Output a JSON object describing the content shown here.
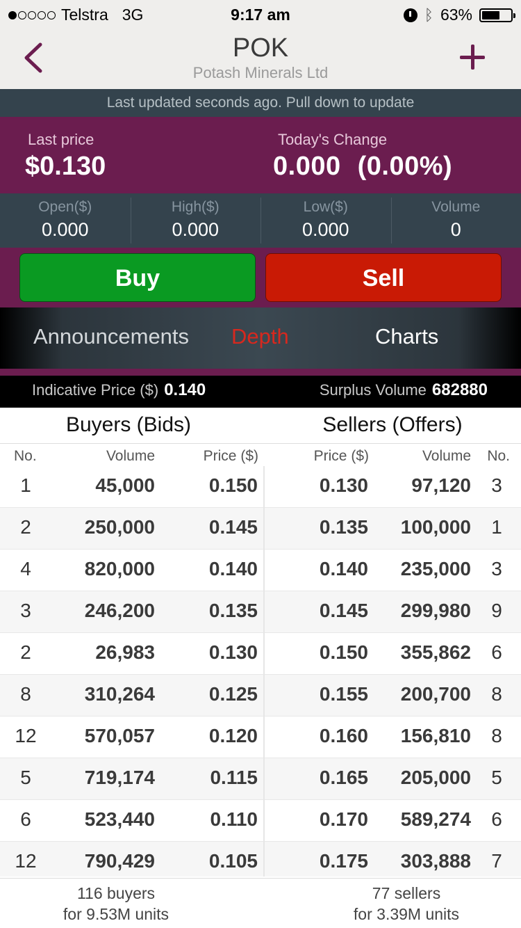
{
  "status_bar": {
    "carrier": "Telstra",
    "network": "3G",
    "time": "9:17 am",
    "battery_percent": "63%",
    "battery_level": 0.63,
    "signal_bars": 1
  },
  "nav": {
    "title": "POK",
    "subtitle": "Potash Minerals Ltd"
  },
  "banner": {
    "text": "Last updated seconds ago. Pull down to update"
  },
  "price": {
    "last_price_label": "Last price",
    "last_price_value": "$0.130",
    "change_label": "Today's Change",
    "change_value": "0.000",
    "change_percent": "(0.00%)"
  },
  "stats": [
    {
      "label": "Open($)",
      "value": "0.000"
    },
    {
      "label": "High($)",
      "value": "0.000"
    },
    {
      "label": "Low($)",
      "value": "0.000"
    },
    {
      "label": "Volume",
      "value": "0"
    }
  ],
  "actions": {
    "buy_label": "Buy",
    "sell_label": "Sell"
  },
  "tabs": {
    "announcements": "Announcements",
    "depth": "Depth",
    "charts": "Charts",
    "active": "Depth"
  },
  "indicative": {
    "price_label": "Indicative Price ($)",
    "price_value": "0.140",
    "surplus_label": "Surplus Volume",
    "surplus_value": "682880"
  },
  "depth": {
    "buyers_title": "Buyers (Bids)",
    "sellers_title": "Sellers (Offers)",
    "columns": {
      "no": "No.",
      "volume": "Volume",
      "price": "Price ($)"
    },
    "rows": [
      {
        "b_no": "1",
        "b_vol": "45,000",
        "b_price": "0.150",
        "s_price": "0.130",
        "s_vol": "97,120",
        "s_no": "3"
      },
      {
        "b_no": "2",
        "b_vol": "250,000",
        "b_price": "0.145",
        "s_price": "0.135",
        "s_vol": "100,000",
        "s_no": "1"
      },
      {
        "b_no": "4",
        "b_vol": "820,000",
        "b_price": "0.140",
        "s_price": "0.140",
        "s_vol": "235,000",
        "s_no": "3"
      },
      {
        "b_no": "3",
        "b_vol": "246,200",
        "b_price": "0.135",
        "s_price": "0.145",
        "s_vol": "299,980",
        "s_no": "9"
      },
      {
        "b_no": "2",
        "b_vol": "26,983",
        "b_price": "0.130",
        "s_price": "0.150",
        "s_vol": "355,862",
        "s_no": "6"
      },
      {
        "b_no": "8",
        "b_vol": "310,264",
        "b_price": "0.125",
        "s_price": "0.155",
        "s_vol": "200,700",
        "s_no": "8"
      },
      {
        "b_no": "12",
        "b_vol": "570,057",
        "b_price": "0.120",
        "s_price": "0.160",
        "s_vol": "156,810",
        "s_no": "8"
      },
      {
        "b_no": "5",
        "b_vol": "719,174",
        "b_price": "0.115",
        "s_price": "0.165",
        "s_vol": "205,000",
        "s_no": "5"
      },
      {
        "b_no": "6",
        "b_vol": "523,440",
        "b_price": "0.110",
        "s_price": "0.170",
        "s_vol": "589,274",
        "s_no": "6"
      },
      {
        "b_no": "12",
        "b_vol": "790,429",
        "b_price": "0.105",
        "s_price": "0.175",
        "s_vol": "303,888",
        "s_no": "7"
      }
    ],
    "footer": {
      "buyers_count": "116 buyers",
      "buyers_units": "for 9.53M units",
      "sellers_count": "77 sellers",
      "sellers_units": "for 3.39M units"
    }
  },
  "colors": {
    "brand": "#6b1d4f",
    "panel_dark": "#34434d",
    "buy": "#0a9a22",
    "sell": "#c91a05",
    "active_tab": "#d7281e"
  }
}
